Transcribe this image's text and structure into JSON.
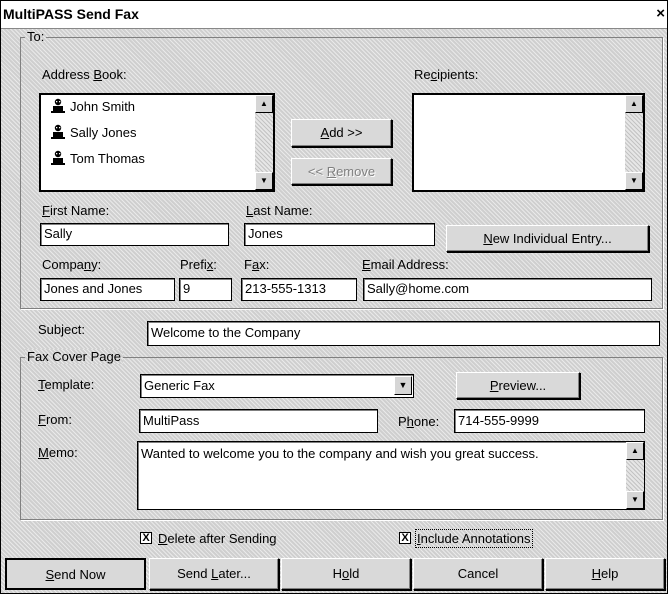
{
  "window": {
    "title": "MultiPASS Send Fax",
    "close_glyph": "×"
  },
  "to_group": {
    "legend": "To:",
    "address_book_label_pre": "Address ",
    "address_book_label_key": "B",
    "address_book_label_post": "ook:",
    "recipients_label_pre": "Re",
    "recipients_label_key": "c",
    "recipients_label_post": "ipients:",
    "address_book": [
      "John Smith",
      "Sally Jones",
      "Tom Thomas"
    ],
    "recipients": [],
    "add_button_key": "A",
    "add_button_rest": "dd >>",
    "remove_button_pre": "<< ",
    "remove_button_key": "R",
    "remove_button_rest": "emove",
    "first_name_key": "F",
    "first_name_rest": "irst Name:",
    "first_name_value": "Sally",
    "last_name_key": "L",
    "last_name_rest": "ast Name:",
    "last_name_value": "Jones",
    "new_entry_key": "N",
    "new_entry_rest": "ew Individual Entry...",
    "company_pre": "Compa",
    "company_key": "n",
    "company_post": "y:",
    "company_value": "Jones and Jones",
    "prefix_pre": "Prefi",
    "prefix_key": "x",
    "prefix_post": ":",
    "prefix_value": "9",
    "fax_pre": "F",
    "fax_key": "a",
    "fax_post": "x:",
    "fax_value": "213-555-1313",
    "email_key": "E",
    "email_rest": "mail Address:",
    "email_value": "Sally@home.com"
  },
  "subject": {
    "label": "Subject:",
    "value": "Welcome to the Company"
  },
  "cover_group": {
    "legend": "Fax Cover Page",
    "template_key": "T",
    "template_rest": "emplate:",
    "template_value": "Generic Fax",
    "preview_key": "P",
    "preview_rest": "review...",
    "from_key": "F",
    "from_rest": "rom:",
    "from_value": "MultiPass",
    "phone_pre": "P",
    "phone_key": "h",
    "phone_post": "one:",
    "phone_value": "714-555-9999",
    "memo_key": "M",
    "memo_rest": "emo:",
    "memo_value": "Wanted to welcome you to the company and wish you great success."
  },
  "options": {
    "delete_after_key": "D",
    "delete_after_rest": "elete after Sending",
    "delete_after_checked": true,
    "include_annotations_key": "I",
    "include_annotations_rest": "nclude Annotations",
    "include_annotations_checked": true,
    "check_glyph": "X"
  },
  "buttons": {
    "send_now_key": "S",
    "send_now_rest": "end Now",
    "send_later_pre": "Send ",
    "send_later_key": "L",
    "send_later_post": "ater...",
    "hold_pre": "H",
    "hold_key": "o",
    "hold_post": "ld",
    "cancel": "Cancel",
    "help_key": "H",
    "help_rest": "elp"
  }
}
